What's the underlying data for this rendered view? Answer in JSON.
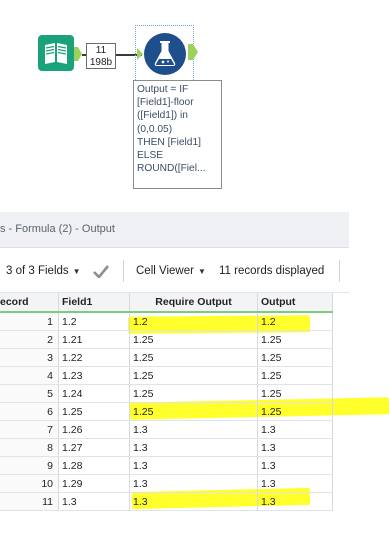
{
  "workflow": {
    "record_badge": {
      "count": "11",
      "size": "198b"
    },
    "annotation_lines": [
      "Output = IF",
      "[Field1]-floor",
      "([Field1]) in",
      "(0,0.05)",
      "THEN [Field1]",
      "ELSE",
      "ROUND([Fiel..."
    ]
  },
  "results": {
    "title": "s - Formula (2) - Output",
    "fields_label": "3 of 3 Fields",
    "cell_viewer_label": "Cell Viewer",
    "records_label": "11 records displayed",
    "columns": [
      "ecord",
      "Field1",
      "Require Output",
      "Output"
    ],
    "rows": [
      [
        "1",
        "1.2",
        "1.2",
        "1.2"
      ],
      [
        "2",
        "1.21",
        "1.25",
        "1.25"
      ],
      [
        "3",
        "1.22",
        "1.25",
        "1.25"
      ],
      [
        "4",
        "1.23",
        "1.25",
        "1.25"
      ],
      [
        "5",
        "1.24",
        "1.25",
        "1.25"
      ],
      [
        "6",
        "1.25",
        "1.25",
        "1.25"
      ],
      [
        "7",
        "1.26",
        "1.3",
        "1.3"
      ],
      [
        "8",
        "1.27",
        "1.3",
        "1.3"
      ],
      [
        "9",
        "1.28",
        "1.3",
        "1.3"
      ],
      [
        "10",
        "1.29",
        "1.3",
        "1.3"
      ],
      [
        "11",
        "1.3",
        "1.3",
        "1.3"
      ]
    ]
  },
  "colors": {
    "highlight": "#ffff1a",
    "header_accent": "#7ecb7e",
    "formula_tool": "#1e4e8c",
    "input_tool": "#1aa37a"
  }
}
